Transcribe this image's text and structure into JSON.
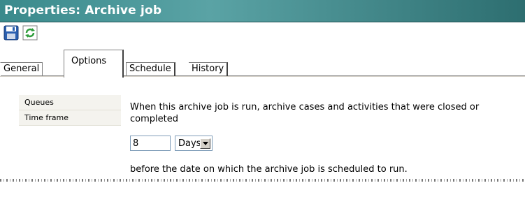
{
  "window": {
    "title": "Properties: Archive job"
  },
  "toolbar": {
    "save_icon": "floppy-disk-save-icon",
    "refresh_icon": "green-refresh-icon"
  },
  "tabs": [
    {
      "label": "General",
      "active": false
    },
    {
      "label": "Options",
      "active": true
    },
    {
      "label": "Schedule",
      "active": false
    },
    {
      "label": "History",
      "active": false
    }
  ],
  "left_nav": [
    {
      "label": "Queues"
    },
    {
      "label": "Time frame"
    }
  ],
  "content": {
    "description": "When this archive job is run, archive cases and activities that were closed or completed",
    "amount_value": "8",
    "unit_selected": "Days",
    "after_text": "before the date on which the archive job is scheduled to run."
  },
  "colors": {
    "title_bar": "#3a8a8c",
    "nav_bg": "#f4f3ee"
  }
}
